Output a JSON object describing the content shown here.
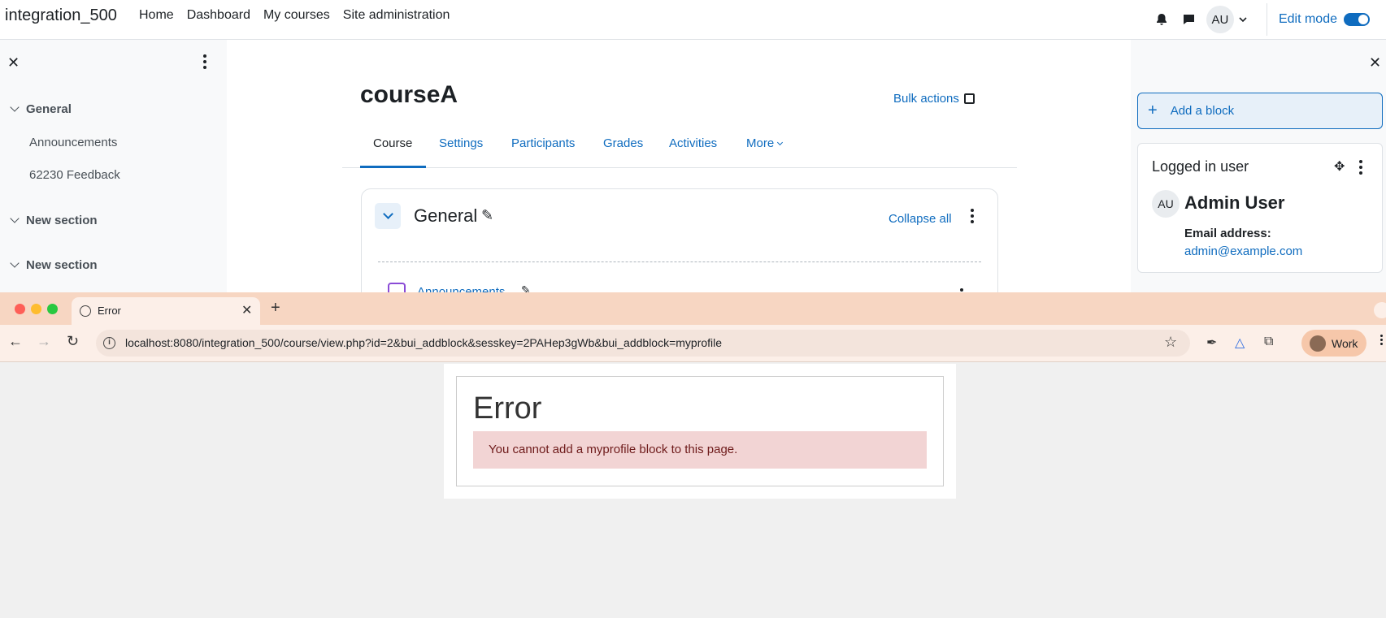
{
  "site": {
    "brand": "integration_500",
    "nav": [
      "Home",
      "Dashboard",
      "My courses",
      "Site administration"
    ],
    "user_initials": "AU",
    "edit_mode_label": "Edit mode"
  },
  "left_drawer": {
    "sections": [
      {
        "title": "General",
        "items": [
          "Announcements",
          "62230 Feedback"
        ]
      },
      {
        "title": "New section",
        "items": []
      },
      {
        "title": "New section",
        "items": []
      }
    ]
  },
  "course": {
    "title": "courseA",
    "bulk_actions": "Bulk actions",
    "tabs": [
      "Course",
      "Settings",
      "Participants",
      "Grades",
      "Activities",
      "More"
    ],
    "active_tab": "Course",
    "section_title": "General",
    "collapse_all": "Collapse all",
    "activity": "Announcements"
  },
  "right_drawer": {
    "add_block": "Add a block",
    "block_title": "Logged in user",
    "user_initials": "AU",
    "user_name": "Admin User",
    "email_label": "Email address:",
    "email": "admin@example.com"
  },
  "browser": {
    "tab_title": "Error",
    "url": "localhost:8080/integration_500/course/view.php?id=2&bui_addblock&sesskey=2PAHep3gWb&bui_addblock=myprofile",
    "profile_label": "Work",
    "colors": {
      "tabstrip": "#f7d6c2",
      "toolbar": "#fcefe8"
    }
  },
  "error_page": {
    "heading": "Error",
    "message": "You cannot add a myprofile block to this page."
  }
}
